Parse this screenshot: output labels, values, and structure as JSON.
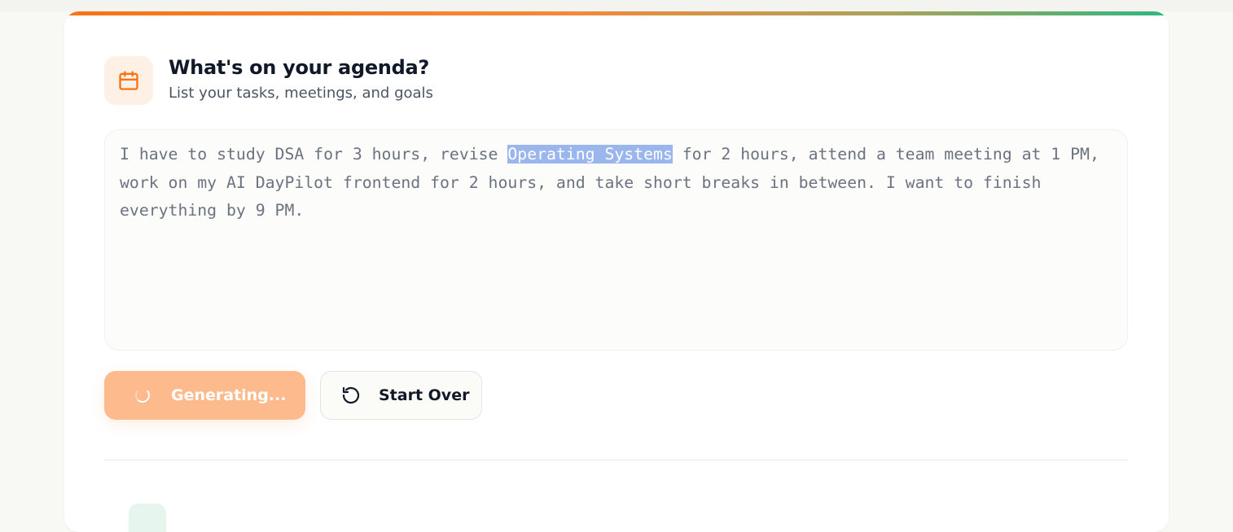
{
  "header": {
    "title": "What's on your agenda?",
    "subtitle": "List your tasks, meetings, and goals",
    "icon": "calendar-icon"
  },
  "prompt": {
    "text_before": "I have to study DSA for 3 hours, revise ",
    "text_selected": "Operating Systems",
    "text_after": " for 2 hours, attend a team meeting at 1 PM, work on my AI DayPilot frontend for 2 hours, and take short breaks in between. I want to finish everything by 9 PM."
  },
  "actions": {
    "generate_label": "Generating...",
    "start_over_label": "Start Over"
  },
  "colors": {
    "accent": "#f97316",
    "accent_light": "#fdba8c",
    "selection": "#9bb6ec",
    "green": "#2fb67f"
  }
}
